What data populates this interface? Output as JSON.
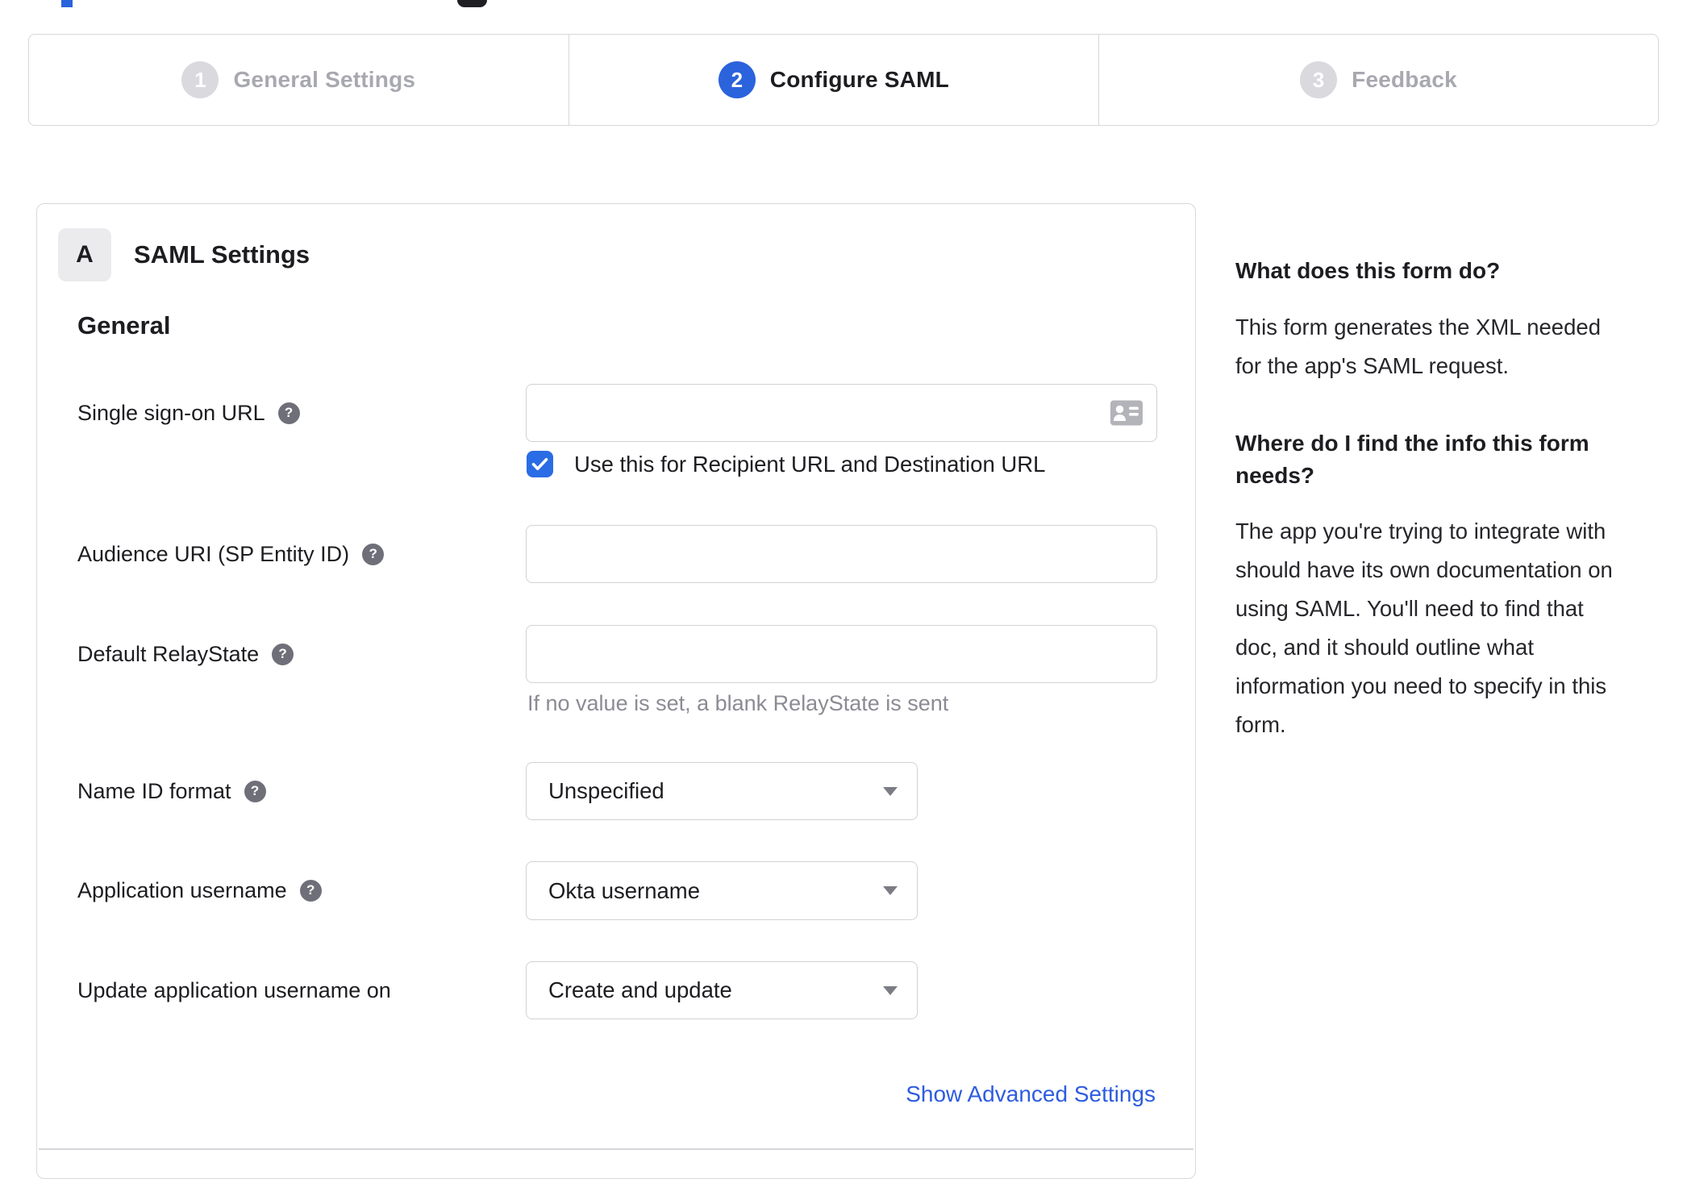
{
  "stepper": {
    "steps": [
      {
        "number": "1",
        "label": "General Settings",
        "state": "inactive"
      },
      {
        "number": "2",
        "label": "Configure SAML",
        "state": "active"
      },
      {
        "number": "3",
        "label": "Feedback",
        "state": "inactive"
      }
    ]
  },
  "panel": {
    "badge": "A",
    "title": "SAML Settings",
    "group": "General",
    "rows": [
      {
        "label": "Single sign-on URL",
        "type": "text",
        "value": ""
      },
      {
        "label": "Audience URI (SP Entity ID)",
        "type": "text",
        "value": ""
      },
      {
        "label": "Default RelayState",
        "type": "text",
        "value": "",
        "hint": "If no value is set, a blank RelayState is sent"
      },
      {
        "label": "Name ID format",
        "type": "select",
        "value": "Unspecified"
      },
      {
        "label": "Application username",
        "type": "select",
        "value": "Okta username"
      },
      {
        "label": "Update application username on",
        "type": "select",
        "value": "Create and update"
      }
    ],
    "sso_checkbox": {
      "checked": true,
      "label": "Use this for Recipient URL and Destination URL"
    },
    "advanced_link": "Show Advanced Settings"
  },
  "sidebar": {
    "q1": "What does this form do?",
    "a1": "This form generates the XML needed\nfor the app's SAML request.",
    "q2": "Where do I find the info this form\nneeds?",
    "a2": "The app you're trying to integrate with\nshould have its own documentation on\nusing SAML. You'll need to find that\ndoc, and it should outline what\ninformation you need to specify in this\nform."
  },
  "colors": {
    "accent_blue": "#2b63dd",
    "checkbox_blue": "#2a6ce5",
    "link_blue": "#2e5ce0",
    "step_inactive_circle": "#d9d9de",
    "step_inactive_text": "#a8a8b0",
    "border_gray": "#d8d8dc",
    "text_dark": "#1d1d21",
    "hint_gray": "#8b8b94"
  }
}
